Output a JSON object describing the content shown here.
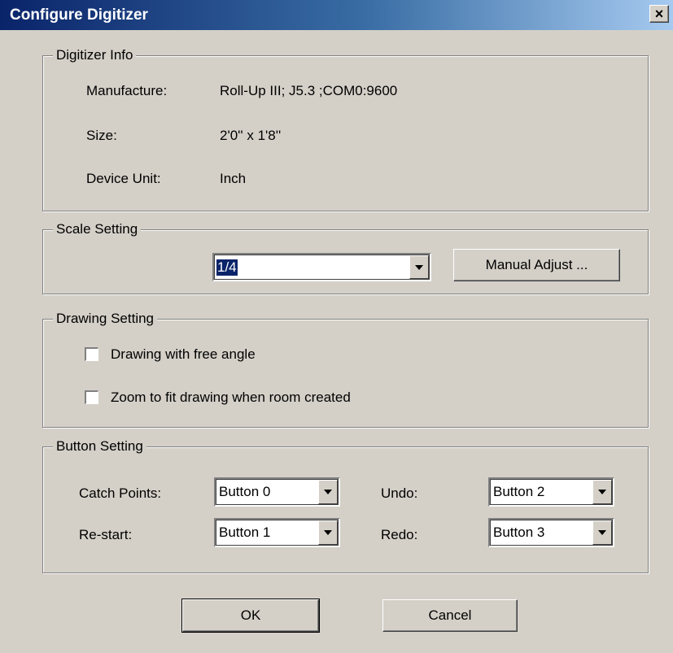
{
  "window": {
    "title": "Configure Digitizer",
    "close_symbol": "×"
  },
  "digitizer_info": {
    "legend": "Digitizer Info",
    "rows": [
      {
        "label": "Manufacture:",
        "value": "Roll-Up III; J5.3 ;COM0:9600"
      },
      {
        "label": "Size:",
        "value": "2'0'' x 1'8''"
      },
      {
        "label": "Device Unit:",
        "value": "Inch"
      }
    ]
  },
  "scale_setting": {
    "legend": "Scale Setting",
    "scale_value": "1/4",
    "manual_adjust_label": "Manual Adjust ..."
  },
  "drawing_setting": {
    "legend": "Drawing Setting",
    "options": [
      {
        "label": "Drawing with free angle",
        "checked": false
      },
      {
        "label": "Zoom to fit drawing when room created",
        "checked": false
      }
    ]
  },
  "button_setting": {
    "legend": "Button Setting",
    "catch_points": {
      "label": "Catch Points:",
      "value": "Button 0"
    },
    "restart": {
      "label": "Re-start:",
      "value": "Button 1"
    },
    "undo": {
      "label": "Undo:",
      "value": "Button 2"
    },
    "redo": {
      "label": "Redo:",
      "value": "Button 3"
    }
  },
  "actions": {
    "ok_label": "OK",
    "cancel_label": "Cancel"
  }
}
